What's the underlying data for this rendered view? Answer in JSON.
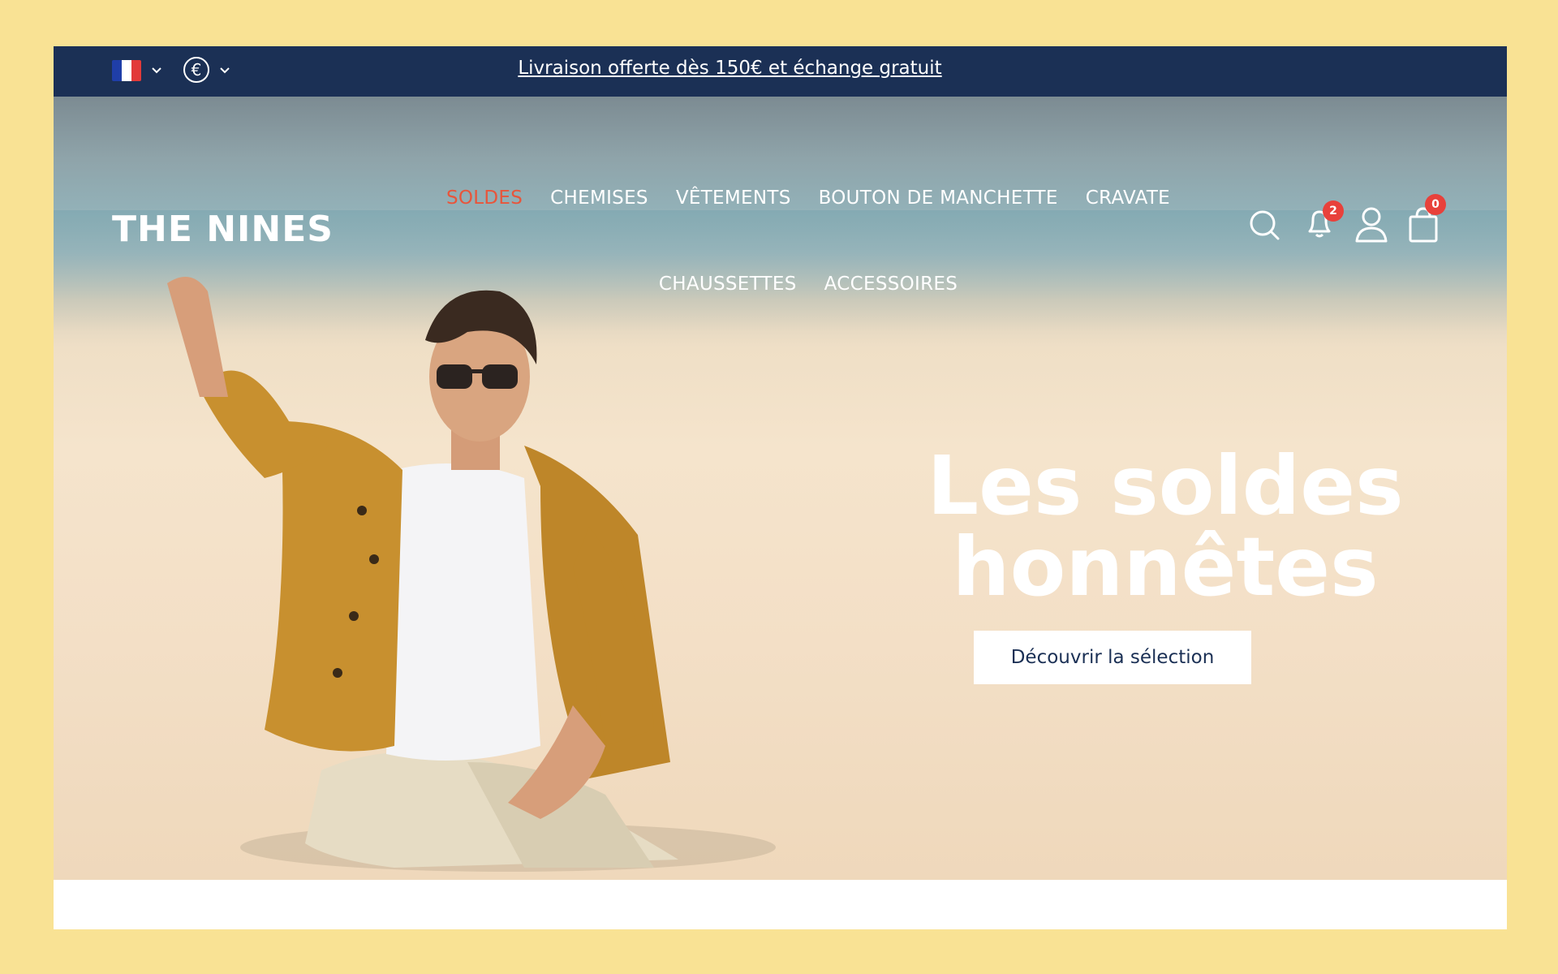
{
  "announcement": {
    "text": "Livraison offerte dès 150€ et échange gratuit"
  },
  "locale": {
    "flag": "france-flag",
    "currency_symbol": "€"
  },
  "header": {
    "logo": "THE NINES",
    "nav": [
      {
        "label": "SOLDES",
        "highlight": true,
        "color": "#e8553b"
      },
      {
        "label": "CHEMISES"
      },
      {
        "label": "VÊTEMENTS"
      },
      {
        "label": "BOUTON DE MANCHETTE"
      },
      {
        "label": "CRAVATE"
      },
      {
        "label": "CHAUSSETTES"
      },
      {
        "label": "ACCESSOIRES"
      }
    ],
    "icons": {
      "search": "search-icon",
      "notifications": "bell-icon",
      "notifications_count": "2",
      "account": "user-icon",
      "cart": "shopping-bag-icon",
      "cart_count": "0"
    }
  },
  "hero": {
    "headline_line1": "Les soldes",
    "headline_line2": "honnêtes",
    "cta": "Découvrir la sélection"
  },
  "colors": {
    "background": "#f9e294",
    "topbar": "#1b3055",
    "sale_accent": "#e8553b",
    "badge": "#e8413b"
  }
}
